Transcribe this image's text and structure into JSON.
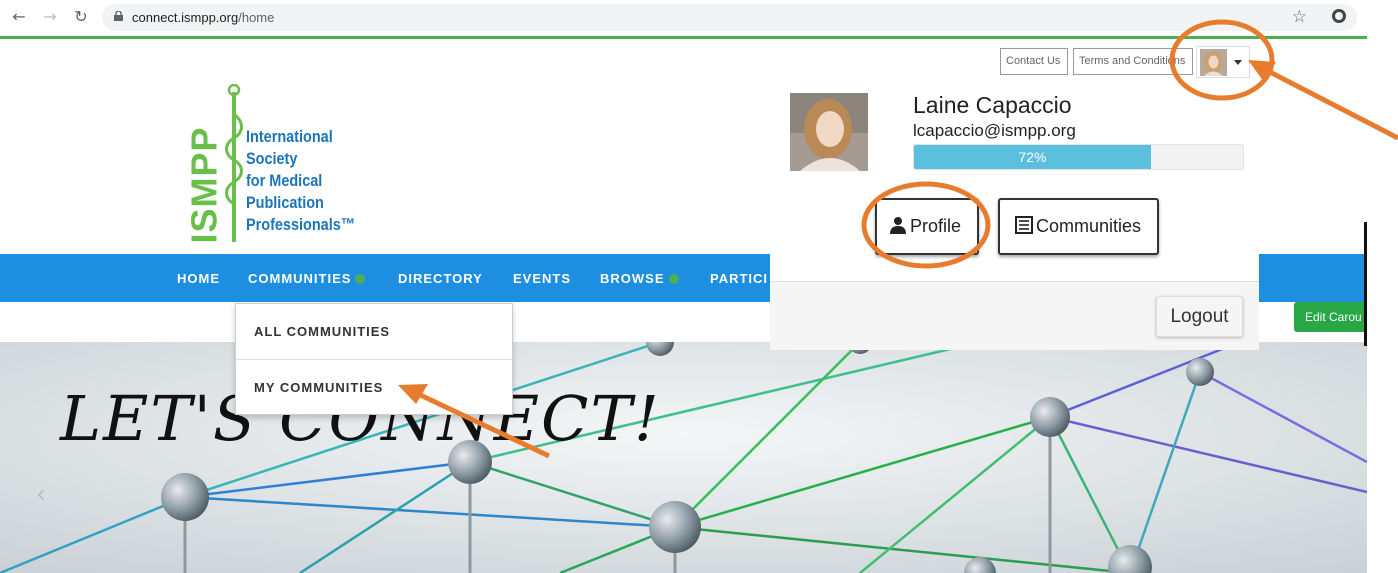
{
  "browser": {
    "url_host": "connect.ismpp.org",
    "url_path": "/home"
  },
  "top_links": {
    "contact_us": "Contact Us",
    "terms": "Terms and Conditions"
  },
  "logo": {
    "acronym": "ISMPP",
    "lines": [
      "International",
      "Society",
      "for Medical",
      "Publication",
      "Professionals™"
    ]
  },
  "nav": {
    "items": [
      "HOME",
      "COMMUNITIES",
      "DIRECTORY",
      "EVENTS",
      "BROWSE",
      "PARTICI"
    ]
  },
  "communities_menu": {
    "items": [
      "ALL COMMUNITIES",
      "MY COMMUNITIES"
    ]
  },
  "hero": {
    "headline": "LET'S CONNECT!"
  },
  "profile_menu": {
    "name": "Laine Capaccio",
    "email": "lcapaccio@ismpp.org",
    "completion_percent": 72,
    "completion_label": "72%",
    "profile_label": "Profile",
    "communities_label": "Communities",
    "logout_label": "Logout"
  },
  "edit_carousel_label": "Edit Carou",
  "colors": {
    "nav_blue": "#1e8ee0",
    "progress": "#5bc0de",
    "annotation_orange": "#e87c2e",
    "logo_green": "#6abf4b",
    "logo_blue": "#1b75bb",
    "edit_green": "#28a745"
  },
  "icons": [
    "back-icon",
    "forward-icon",
    "reload-icon",
    "lock-icon",
    "star-icon",
    "extension-icon",
    "user-icon",
    "list-icon",
    "caret-down-icon"
  ]
}
